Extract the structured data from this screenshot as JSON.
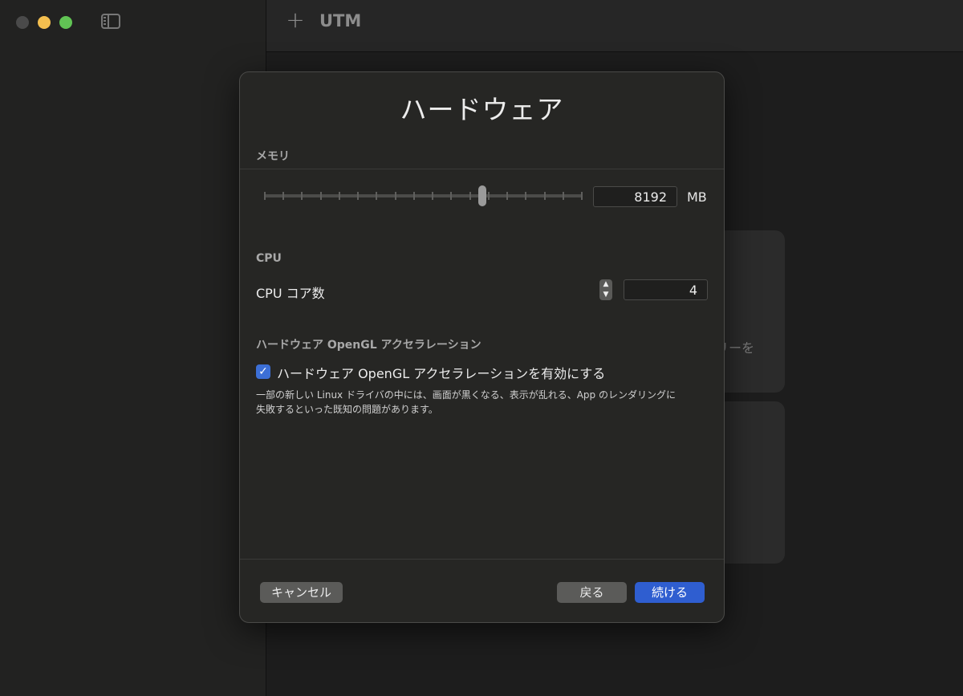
{
  "window": {
    "app_title": "UTM",
    "background_text": "リーを"
  },
  "dialog": {
    "title": "ハードウェア",
    "memory": {
      "section_label": "メモリ",
      "value": "8192",
      "unit": "MB",
      "slider_position": 0.69
    },
    "cpu": {
      "section_label": "CPU",
      "cores_label": "CPU コア数",
      "cores_value": "4"
    },
    "opengl": {
      "section_label": "ハードウェア OpenGL アクセラレーション",
      "checkbox_label": "ハードウェア OpenGL アクセラレーションを有効にする",
      "checked": true,
      "help_line1": "一部の新しい Linux ドライバの中には、画面が黒くなる、表示が乱れる、App のレンダリングに",
      "help_line2": "失敗するといった既知の問題があります。"
    },
    "buttons": {
      "cancel": "キャンセル",
      "back": "戻る",
      "continue": "続ける"
    }
  },
  "colors": {
    "accent": "#2f5ed0",
    "checkbox": "#3c6fd6",
    "traffic_close": "#4a4a4a",
    "traffic_minimize": "#f4bf4f",
    "traffic_maximize": "#61c454"
  }
}
